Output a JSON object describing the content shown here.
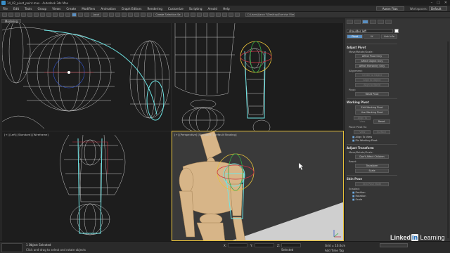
{
  "window": {
    "title": "14_02_pivot_point.max - Autodesk 3ds Max",
    "minimize_glyph": "–",
    "maximize_glyph": "□",
    "close_glyph": "✕"
  },
  "menu": {
    "items": [
      "File",
      "Edit",
      "Tools",
      "Group",
      "Views",
      "Create",
      "Modifiers",
      "Animation",
      "Graph Editors",
      "Rendering",
      "Customize",
      "Scripting",
      "Arnold",
      "Help"
    ],
    "user": "Aaron Fitzs",
    "workspaces_label": "Workspaces:",
    "workspace_value": "Default"
  },
  "toolbar": {
    "coord_system": "Local",
    "selection_set": "Create Selection Se",
    "project_path": "C:\\Users\\Aaron F\\Desktop\\Exercise Files\\"
  },
  "tabs": [
    "Modeling"
  ],
  "viewports": {
    "top_left_label": "",
    "top_right_label": "",
    "bottom_left_label": "[+] [Left] [Standard] [Wireframe]",
    "bottom_right_label": "[+] [Perspective] [Standard] [Default Shading]"
  },
  "panel": {
    "object_name": "shoulder left",
    "modes": [
      "Pivot",
      "IK",
      "Link Info"
    ],
    "adjust_pivot": {
      "title": "Adjust Pivot",
      "move_label": "Move/Rotate/Scale:",
      "buttons": [
        "Affect Pivot Only",
        "Affect Object Only",
        "Affect Hierarchy Only"
      ],
      "alignment_label": "Alignment:",
      "align_buttons": [
        "Center to Object",
        "Align to Object",
        "Align to World"
      ],
      "pivot_label": "Pivot:",
      "reset_button": "Reset Pivot"
    },
    "working_pivot": {
      "title": "Working Pivot",
      "buttons": [
        "Edit Working Pivot",
        "Use Working Pivot"
      ],
      "align_view": "Align To View",
      "reset_button": "Reset",
      "place_label": "Place Pivot To:",
      "place_buttons": [
        "View",
        "Surface"
      ],
      "checks": [
        "Align To View",
        "Pin Working Pivot"
      ]
    },
    "adjust_transform": {
      "title": "Adjust Transform",
      "move_label": "Move/Rotate/Scale:",
      "dont_affect": "Don't Affect Children",
      "reset_label": "Reset:",
      "buttons": [
        "Transform",
        "Scale"
      ]
    },
    "skin_pose": {
      "title": "Skin Pose",
      "use_pose_button": "Skin Pose Mode",
      "enabled_label": "Enabled:",
      "checks": [
        "Position",
        "Rotation",
        "Scale"
      ]
    }
  },
  "status": {
    "selection": "1 Object Selected",
    "hint": "Click and drag to select and rotate objects",
    "x_label": "X:",
    "y_label": "Y:",
    "z_label": "Z:",
    "grid": "Grid = 10.0cm",
    "autokey_label": "Selected",
    "add_time_tag": "Add Time Tag"
  },
  "watermark": {
    "brand": "Linked",
    "brand_in": "in",
    "suffix": "Learning"
  },
  "colors": {
    "active_viewport_border": "#e8c23a",
    "selection_cyan": "#6fe6e6",
    "wire_white": "#e6e6e6",
    "mannequin_wood": "#d7b588"
  }
}
